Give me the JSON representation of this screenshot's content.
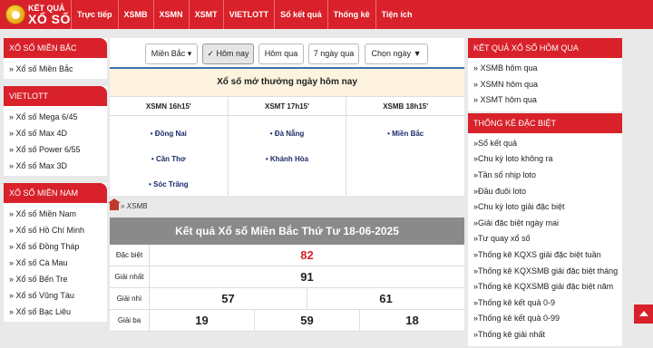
{
  "logo": {
    "line1": "KẾT QUẢ",
    "line2": "XỔ SỐ"
  },
  "nav": [
    "Trực tiếp",
    "XSMB",
    "XSMN",
    "XSMT",
    "VIETLOTT",
    "Sổ kết quả",
    "Thống kê",
    "Tiện ích"
  ],
  "left": {
    "boxes": [
      {
        "title": "XỔ SỐ MIỀN BẮC",
        "items": [
          "» Xổ số Miền Bắc"
        ]
      },
      {
        "title": "VIETLOTT",
        "items": [
          "» Xổ số Mega 6/45",
          "» Xổ số Max 4D",
          "» Xổ số Power 6/55",
          "» Xổ số Max 3D"
        ]
      },
      {
        "title": "XỔ SỐ MIỀN NAM",
        "items": [
          "» Xổ số Miền Nam",
          "» Xổ số Hồ Chí Minh",
          "» Xổ số Đồng Tháp",
          "» Xổ số Cà Mau",
          "» Xổ số Bến Tre",
          "» Xổ số Vũng Tàu",
          "» Xổ số Bạc Liêu"
        ]
      }
    ]
  },
  "filter": {
    "region": "Miền Bắc",
    "today": "Hôm nay",
    "yesterday": "Hôm qua",
    "week": "7 ngày qua",
    "pick": "Chọn ngày"
  },
  "schedule": {
    "heading": "Xổ số mở thưởng ngày hôm nay",
    "columns": [
      {
        "title": "XSMN 16h15'",
        "provinces": [
          "• Đồng Nai",
          "• Cần Thơ",
          "• Sóc Trăng"
        ]
      },
      {
        "title": "XSMT 17h15'",
        "provinces": [
          "• Đà Nẵng",
          "• Khánh Hòa"
        ]
      },
      {
        "title": "XSMB 18h15'",
        "provinces": [
          "• Miền Bắc"
        ]
      }
    ]
  },
  "breadcrumb": "» XSMB",
  "result": {
    "title": "Kết quả Xổ số Miền Bắc Thứ Tư 18-06-2025",
    "rows": [
      {
        "label": "Đặc biệt",
        "values": [
          "82"
        ]
      },
      {
        "label": "Giải nhất",
        "values": [
          "91"
        ]
      },
      {
        "label": "Giải nhì",
        "values": [
          "57",
          "61"
        ]
      },
      {
        "label": "Giải ba",
        "values": [
          "19",
          "59",
          "18"
        ]
      }
    ]
  },
  "right": {
    "yesterday": {
      "title": "KẾT QUẢ XỔ SỐ HÔM QUA",
      "items": [
        "» XSMB hôm qua",
        "» XSMN hôm qua",
        "» XSMT hôm qua"
      ]
    },
    "stats": {
      "title": "THỐNG KÊ ĐẶC BIỆT",
      "items": [
        "»Sổ kết quả",
        "»Chu kỳ loto không ra",
        "»Tần số nhịp loto",
        "»Đầu đuôi loto",
        "»Chu kỳ loto giải đặc biệt",
        "»Giải đặc biệt ngày mai",
        "»Tư quay xổ số",
        "»Thống kê KQXS giải đặc biệt tuần",
        "»Thống kê KQXSMB giải đặc biệt tháng",
        "»Thống kê KQXSMB giải đặc biệt năm",
        "»Thống kê kết quả 0-9",
        "»Thống kê kết quả 0-99",
        "»Thống kê giải nhất"
      ]
    }
  },
  "colors": {
    "brand": "#d8212a",
    "header_gray": "#8a8a8a",
    "heading_bg": "#fdf3de",
    "province_text": "#1a2b6b"
  }
}
